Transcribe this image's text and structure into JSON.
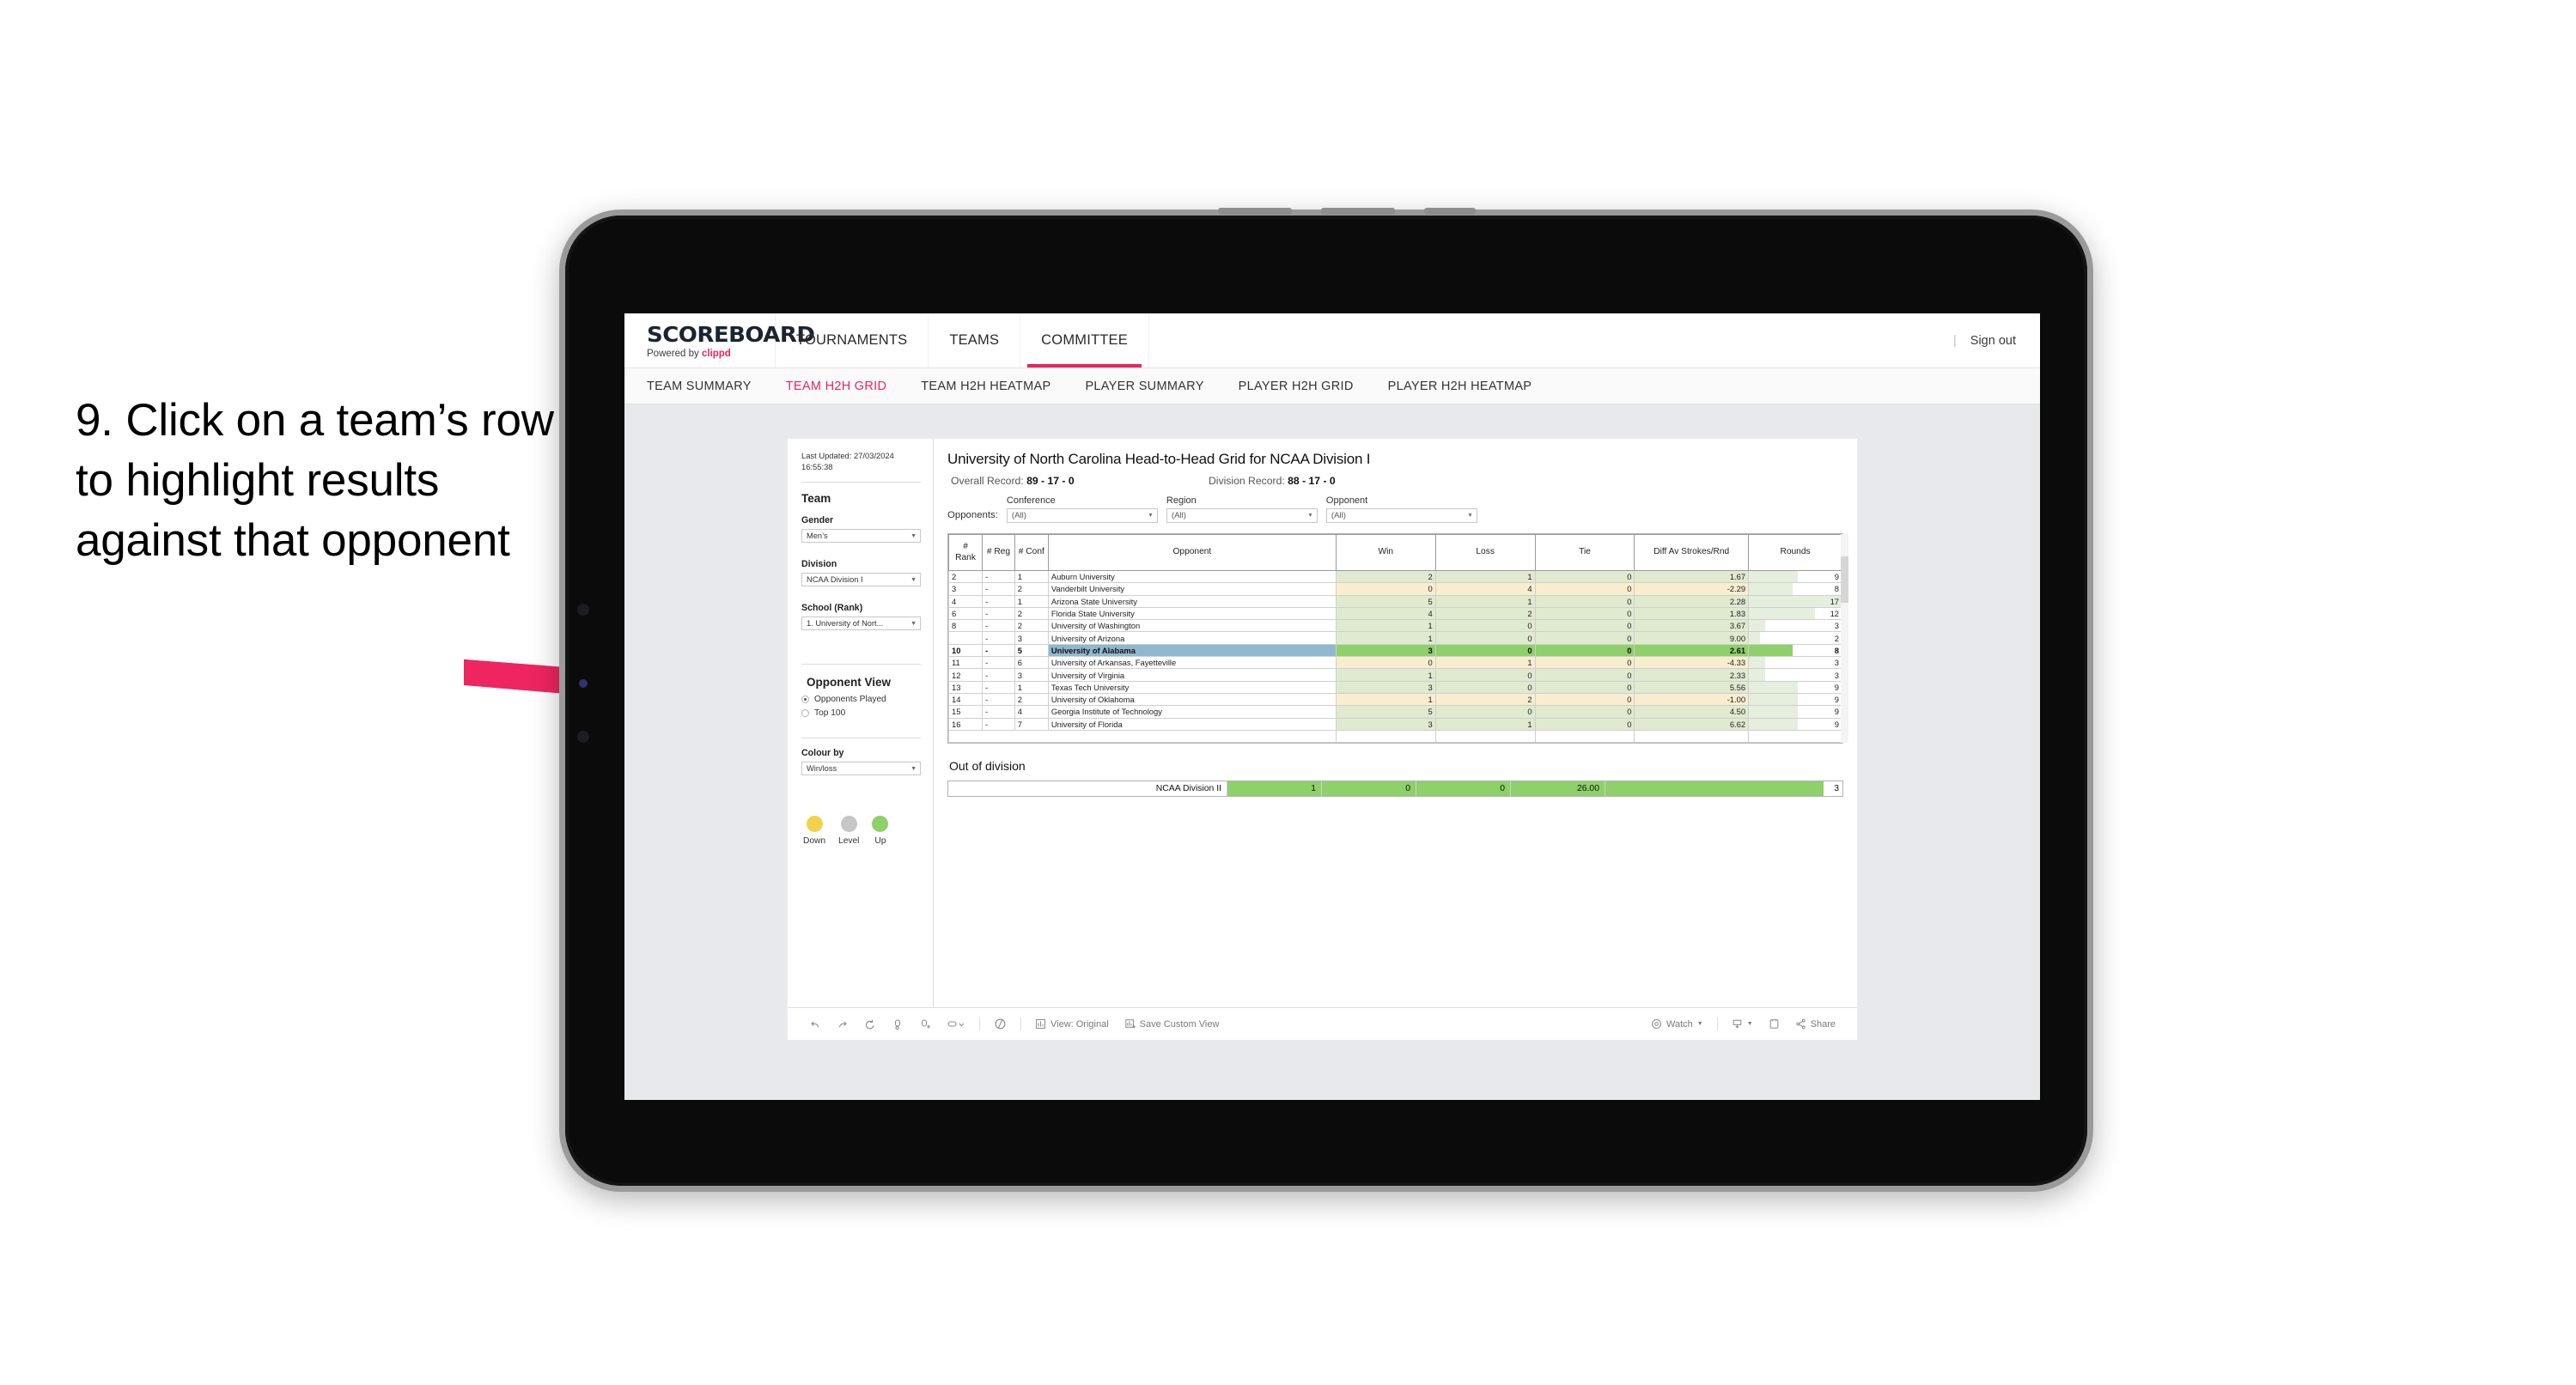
{
  "caption": "9. Click on a team’s row to highlight results against that opponent",
  "brand": {
    "title": "SCOREBOARD",
    "powered_prefix": "Powered by ",
    "powered_name": "clippd",
    "accent": "#e8255f"
  },
  "top_nav": {
    "items": [
      {
        "label": "TOURNAMENTS",
        "active": false
      },
      {
        "label": "TEAMS",
        "active": false
      },
      {
        "label": "COMMITTEE",
        "active": true
      }
    ],
    "divider": "|",
    "sign_out": "Sign out"
  },
  "sub_nav": {
    "items": [
      {
        "label": "TEAM SUMMARY",
        "active": false
      },
      {
        "label": "TEAM H2H GRID",
        "active": true
      },
      {
        "label": "TEAM H2H HEATMAP",
        "active": false
      },
      {
        "label": "PLAYER SUMMARY",
        "active": false
      },
      {
        "label": "PLAYER H2H GRID",
        "active": false
      },
      {
        "label": "PLAYER H2H HEATMAP",
        "active": false
      }
    ]
  },
  "sidebar": {
    "last_updated": "Last Updated: 27/03/2024 16:55:38",
    "team_heading": "Team",
    "gender": {
      "label": "Gender",
      "value": "Men’s"
    },
    "division": {
      "label": "Division",
      "value": "NCAA Division I"
    },
    "school": {
      "label": "School (Rank)",
      "value": "1. University of Nort..."
    },
    "opponent_view": {
      "heading": "Opponent View",
      "options": [
        {
          "label": "Opponents Played",
          "selected": true
        },
        {
          "label": "Top 100",
          "selected": false
        }
      ]
    },
    "colour_by": {
      "label": "Colour by",
      "value": "Win/loss"
    },
    "legend": [
      {
        "label": "Down",
        "color": "#f2d24b"
      },
      {
        "label": "Level",
        "color": "#c4c7c8"
      },
      {
        "label": "Up",
        "color": "#8ed06a"
      }
    ]
  },
  "main": {
    "title": "University of North Carolina Head-to-Head Grid for NCAA Division I",
    "overall_record_label": "Overall Record:",
    "overall_record_value": "89 - 17 - 0",
    "division_record_label": "Division Record:",
    "division_record_value": "88 - 17 - 0",
    "opponents_label": "Opponents:",
    "filters": [
      {
        "label": "Conference",
        "value": "(All)"
      },
      {
        "label": "Region",
        "value": "(All)"
      },
      {
        "label": "Opponent",
        "value": "(All)"
      }
    ]
  },
  "chart_data": {
    "type": "table",
    "title": "University of North Carolina Head-to-Head Grid for NCAA Division I",
    "columns": [
      "# Rank",
      "# Reg",
      "# Conf",
      "Opponent",
      "Win",
      "Loss",
      "Tie",
      "Diff Av Strokes/Rnd",
      "Rounds"
    ],
    "legend": [
      "Down",
      "Level",
      "Up"
    ],
    "selected_row": "University of Alabama",
    "rows": [
      {
        "rank": "2",
        "reg": "-",
        "conf": "1",
        "opponent": "Auburn University",
        "win": "2",
        "loss": "1",
        "tie": "0",
        "diff": "1.67",
        "rounds": "9",
        "tone": "up",
        "selected": false,
        "bar_pct": 53
      },
      {
        "rank": "3",
        "reg": "-",
        "conf": "2",
        "opponent": "Vanderbilt University",
        "win": "0",
        "loss": "4",
        "tie": "0",
        "diff": "-2.29",
        "rounds": "8",
        "tone": "down",
        "selected": false,
        "bar_pct": 47
      },
      {
        "rank": "4",
        "reg": "-",
        "conf": "1",
        "opponent": "Arizona State University",
        "win": "5",
        "loss": "1",
        "tie": "0",
        "diff": "2.28",
        "rounds": "17",
        "tone": "up",
        "selected": false,
        "bar_pct": 100
      },
      {
        "rank": "6",
        "reg": "-",
        "conf": "2",
        "opponent": "Florida State University",
        "win": "4",
        "loss": "2",
        "tie": "0",
        "diff": "1.83",
        "rounds": "12",
        "tone": "up",
        "selected": false,
        "bar_pct": 71
      },
      {
        "rank": "8",
        "reg": "-",
        "conf": "2",
        "opponent": "University of Washington",
        "win": "1",
        "loss": "0",
        "tie": "0",
        "diff": "3.67",
        "rounds": "3",
        "tone": "up",
        "selected": false,
        "bar_pct": 18
      },
      {
        "rank": "",
        "reg": "-",
        "conf": "3",
        "opponent": "University of Arizona",
        "win": "1",
        "loss": "0",
        "tie": "0",
        "diff": "9.00",
        "rounds": "2",
        "tone": "up",
        "selected": false,
        "bar_pct": 12
      },
      {
        "rank": "10",
        "reg": "-",
        "conf": "5",
        "opponent": "University of Alabama",
        "win": "3",
        "loss": "0",
        "tie": "0",
        "diff": "2.61",
        "rounds": "8",
        "tone": "up",
        "selected": true,
        "bar_pct": 47
      },
      {
        "rank": "11",
        "reg": "-",
        "conf": "6",
        "opponent": "University of Arkansas, Fayetteville",
        "win": "0",
        "loss": "1",
        "tie": "0",
        "diff": "-4.33",
        "rounds": "3",
        "tone": "down",
        "selected": false,
        "bar_pct": 18
      },
      {
        "rank": "12",
        "reg": "-",
        "conf": "3",
        "opponent": "University of Virginia",
        "win": "1",
        "loss": "0",
        "tie": "0",
        "diff": "2.33",
        "rounds": "3",
        "tone": "up",
        "selected": false,
        "bar_pct": 18
      },
      {
        "rank": "13",
        "reg": "-",
        "conf": "1",
        "opponent": "Texas Tech University",
        "win": "3",
        "loss": "0",
        "tie": "0",
        "diff": "5.56",
        "rounds": "9",
        "tone": "up",
        "selected": false,
        "bar_pct": 53
      },
      {
        "rank": "14",
        "reg": "-",
        "conf": "2",
        "opponent": "University of Oklahoma",
        "win": "1",
        "loss": "2",
        "tie": "0",
        "diff": "-1.00",
        "rounds": "9",
        "tone": "down",
        "selected": false,
        "bar_pct": 53
      },
      {
        "rank": "15",
        "reg": "-",
        "conf": "4",
        "opponent": "Georgia Institute of Technology",
        "win": "5",
        "loss": "0",
        "tie": "0",
        "diff": "4.50",
        "rounds": "9",
        "tone": "up",
        "selected": false,
        "bar_pct": 53
      },
      {
        "rank": "16",
        "reg": "-",
        "conf": "7",
        "opponent": "University of Florida",
        "win": "3",
        "loss": "1",
        "tie": "0",
        "diff": "6.62",
        "rounds": "9",
        "tone": "up",
        "selected": false,
        "bar_pct": 53
      }
    ],
    "out_of_division": {
      "heading": "Out of division",
      "label": "NCAA Division II",
      "win": "1",
      "loss": "0",
      "tie": "0",
      "diff": "26.00",
      "rounds": "3"
    },
    "colors": {
      "up_strong": "#8ed06a",
      "up_faint": "#dfeacf",
      "down_faint": "#f8edcf",
      "selected_row": "#8fb8cf",
      "rounds_bar": "#e6eedd"
    }
  },
  "toolbar": {
    "view_label": "View: Original",
    "save_label": "Save Custom View",
    "watch_label": "Watch",
    "share_label": "Share"
  }
}
